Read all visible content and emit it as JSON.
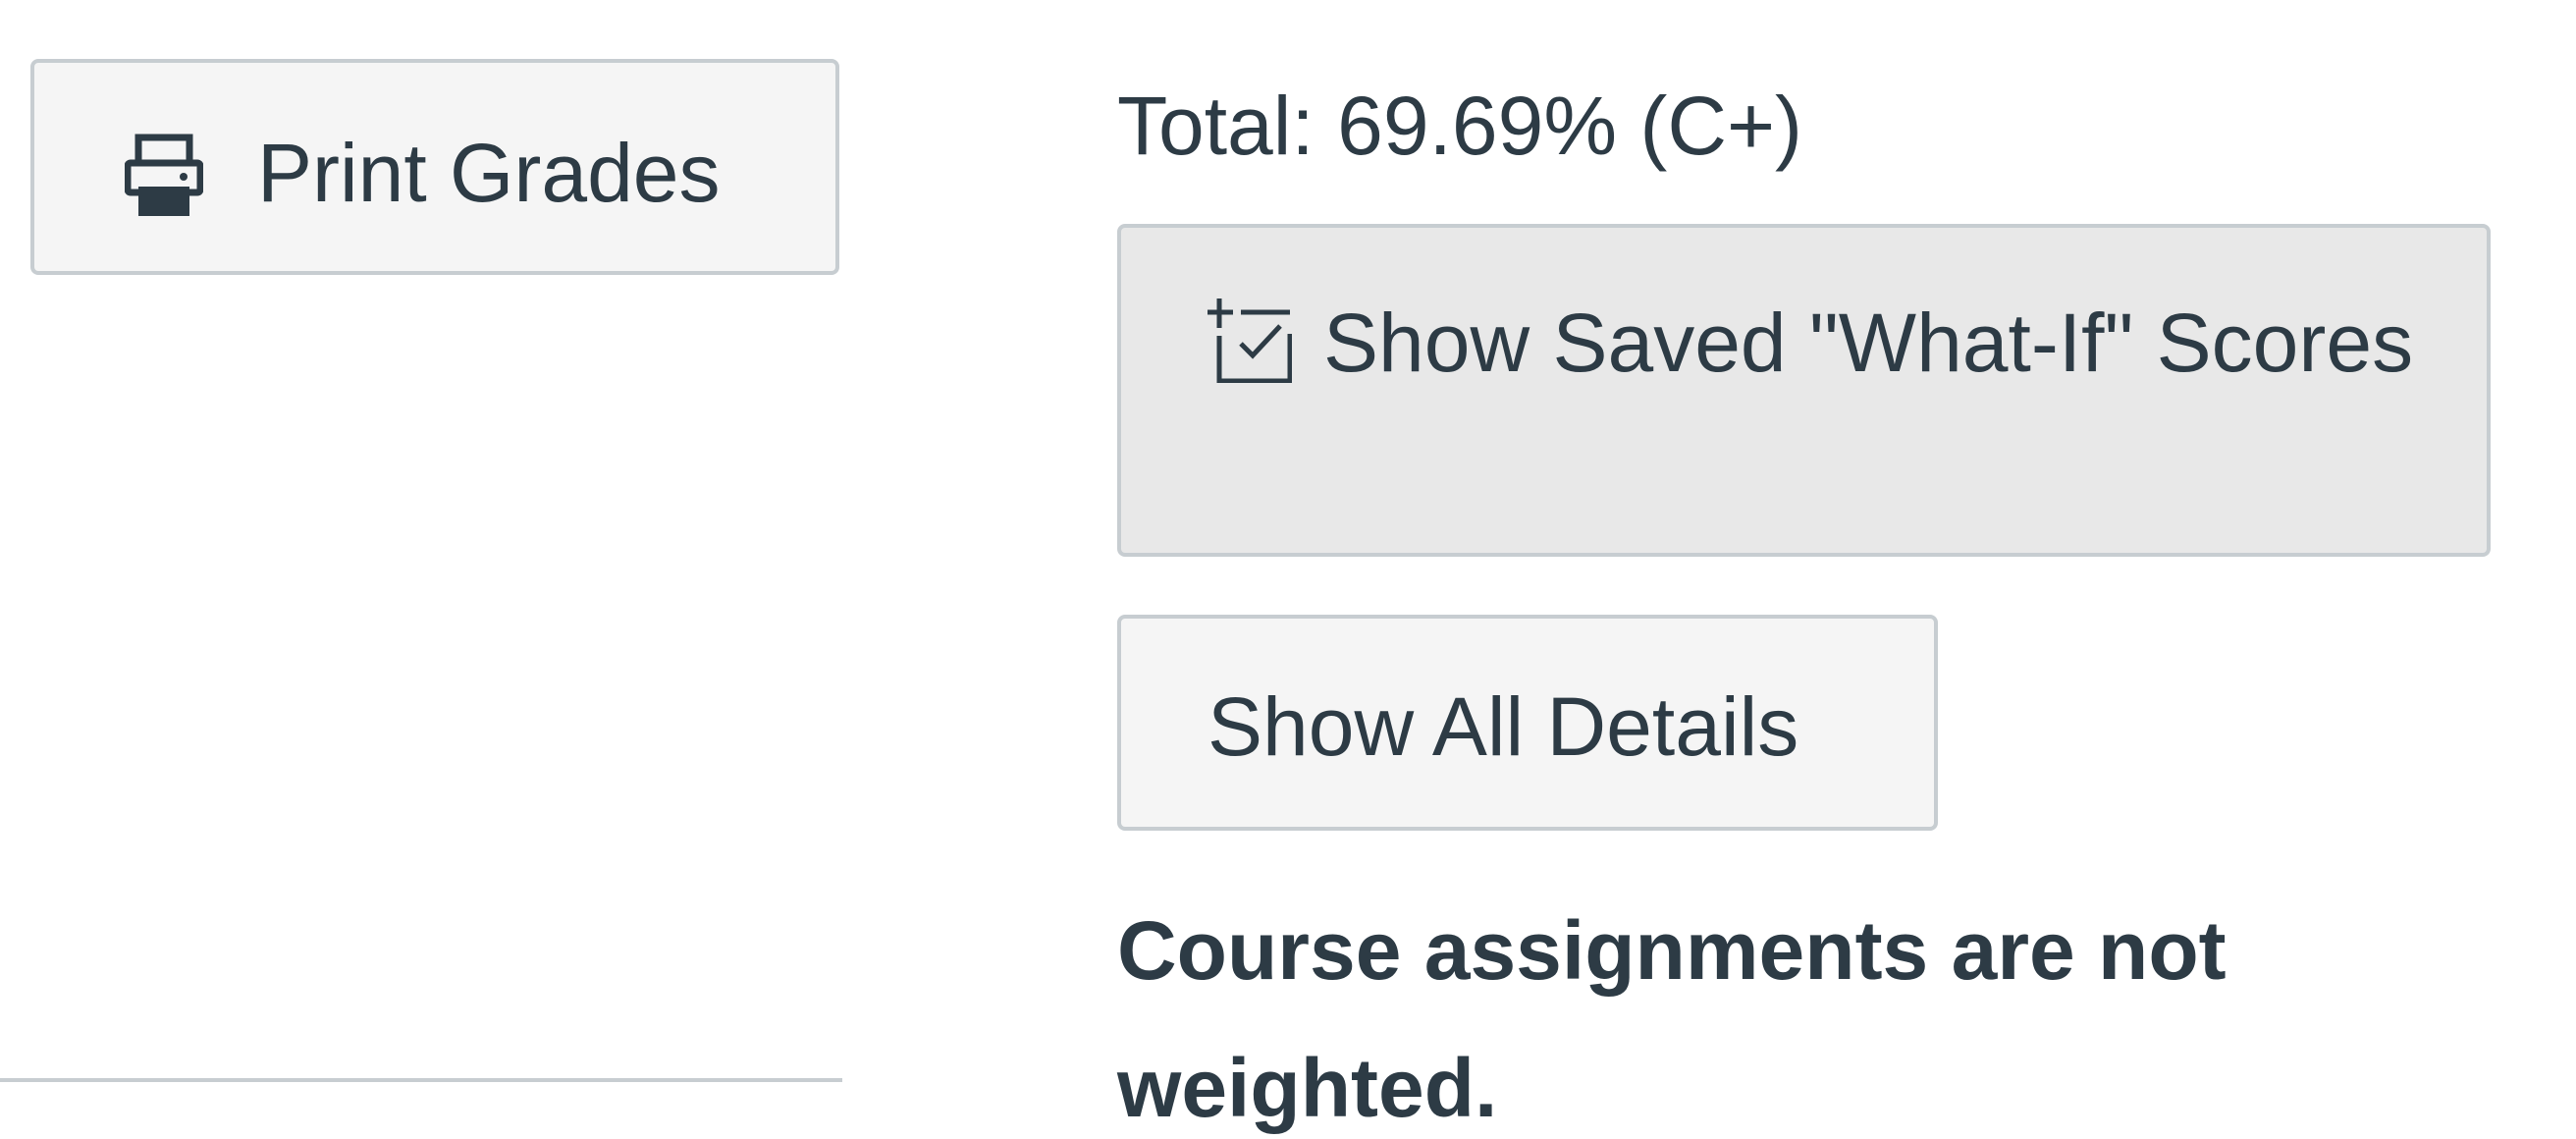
{
  "sidebar": {
    "print_button": {
      "label": "Print Grades",
      "icon": "printer-icon"
    }
  },
  "grades": {
    "total_text": "Total: 69.69% (C+)",
    "whatif_button": {
      "label": "Show Saved \"What-If\" Scores",
      "icon": "calendar-check-icon"
    },
    "details_button": {
      "label": "Show All Details"
    },
    "weight_note": "Course assignments are not weighted."
  },
  "colors": {
    "text": "#2d3b45",
    "button_bg": "#f5f5f5",
    "button_active_bg": "#e8e8e8",
    "border": "#c7cdd1"
  }
}
